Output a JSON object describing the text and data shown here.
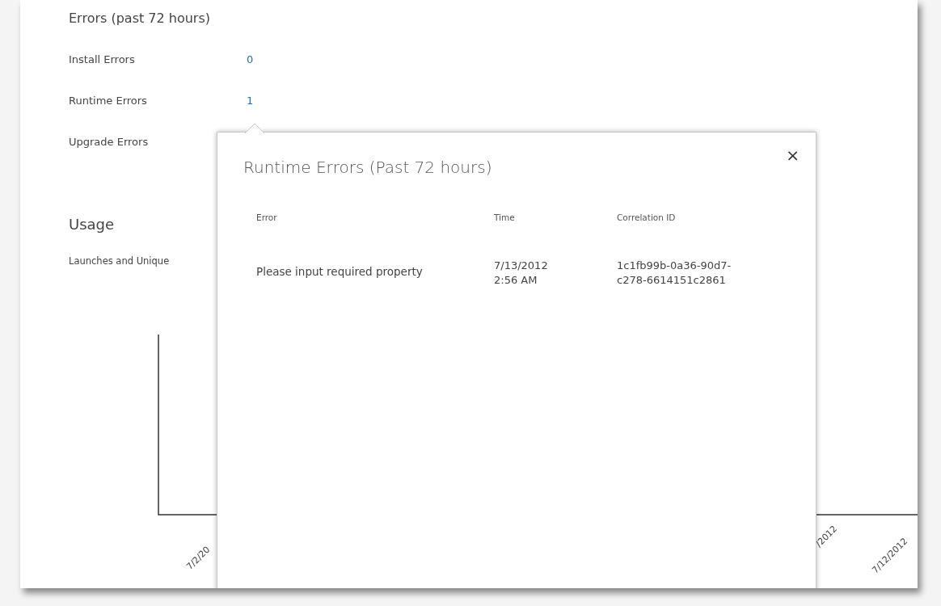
{
  "errors_section": {
    "title": "Errors (past 72 hours)",
    "rows": [
      {
        "label": "Install Errors",
        "count": "0"
      },
      {
        "label": "Runtime Errors",
        "count": "1"
      },
      {
        "label": "Upgrade Errors"
      }
    ]
  },
  "usage_section": {
    "title": "Usage",
    "chart_title": "Launches and Unique",
    "x_labels": [
      "7/2/20",
      "/2012",
      "7/12/2012"
    ]
  },
  "popup": {
    "title": "Runtime Errors (Past 72 hours)",
    "close": "×",
    "columns": [
      "Error",
      "Time",
      "Correlation ID"
    ],
    "rows": [
      {
        "error": "Please input required property",
        "time": [
          "7/13/2012",
          "2:56 AM"
        ],
        "correlation_id": [
          "1c1fb99b-0a36-90d7-",
          "c278-6614151c2861"
        ]
      }
    ]
  }
}
